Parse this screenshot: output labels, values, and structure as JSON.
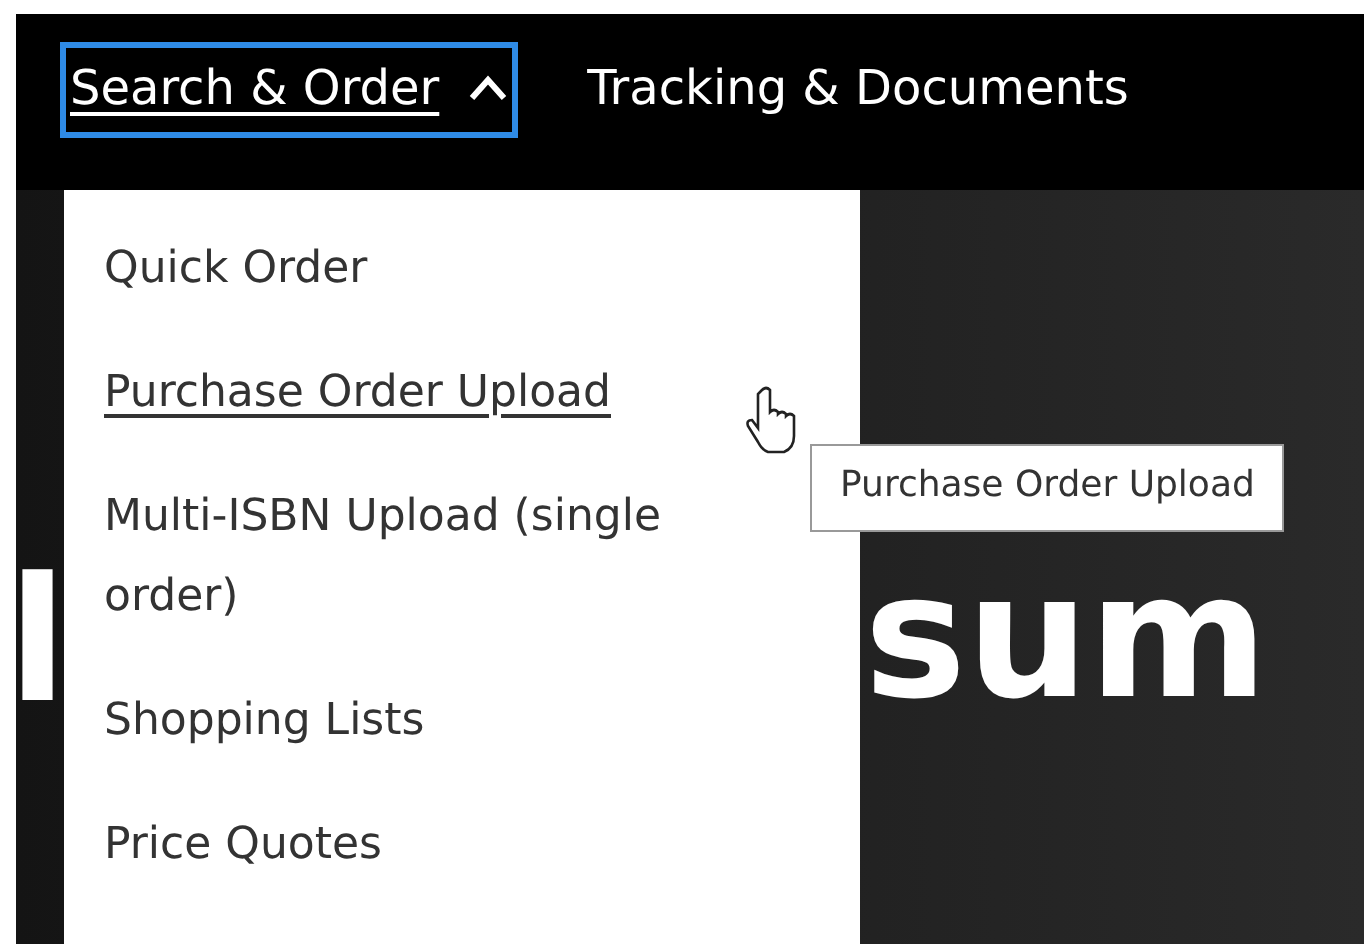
{
  "nav": {
    "items": [
      {
        "label": "Search & Order",
        "expanded": true,
        "focused": true
      },
      {
        "label": "Tracking & Documents",
        "expanded": false,
        "focused": false
      }
    ]
  },
  "menu": {
    "items": [
      {
        "label": "Quick Order",
        "hovered": false
      },
      {
        "label": "Purchase Order Upload",
        "hovered": true
      },
      {
        "label": "Multi-ISBN Upload (single order)",
        "hovered": false
      },
      {
        "label": "Shopping Lists",
        "hovered": false
      },
      {
        "label": "Price Quotes",
        "hovered": false
      }
    ]
  },
  "tooltip": {
    "text": "Purchase Order Upload"
  },
  "hero": {
    "fragments": [
      "l",
      "sum"
    ]
  }
}
